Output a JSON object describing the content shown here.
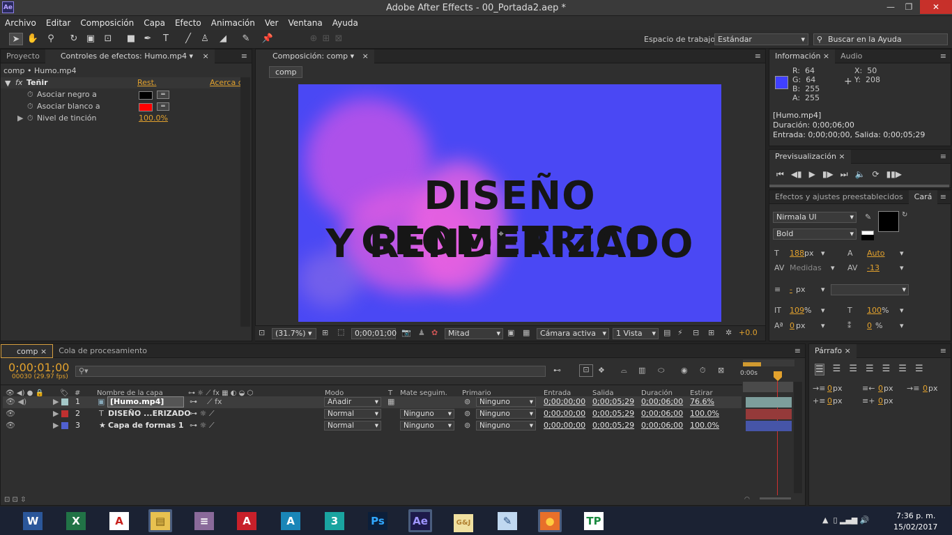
{
  "window": {
    "title": "Adobe After Effects - 00_Portada2.aep *",
    "app_badge": "Ae"
  },
  "menu": [
    "Archivo",
    "Editar",
    "Composición",
    "Capa",
    "Efecto",
    "Animación",
    "Ver",
    "Ventana",
    "Ayuda"
  ],
  "workspace": {
    "label": "Espacio de trabajo:",
    "value": "Estándar",
    "search_placeholder": "Buscar en la Ayuda"
  },
  "left_panel": {
    "tabs": [
      "Proyecto",
      "Controles de efectos: Humo.mp4"
    ],
    "breadcrumb": "comp • Humo.mp4",
    "effect_name": "Teñir",
    "reset": "Rest.",
    "about": "Acerca d",
    "params": [
      {
        "label": "Asociar negro a",
        "color": "#000000"
      },
      {
        "label": "Asociar blanco a",
        "color": "#ff0000"
      },
      {
        "label": "Nivel de tinción",
        "value": "100.0%"
      }
    ]
  },
  "viewer": {
    "tab": "Composición: comp",
    "comp_label": "comp",
    "line1": "DISEÑO GEOMETRICO",
    "line2": "Y RENDERIZADO",
    "bg_color": "#4a48f4",
    "zoom": "(31.7%)",
    "timecode": "0;00;01;00",
    "resolution": "Mitad",
    "camera": "Cámara activa",
    "views": "1 Vista",
    "exposure": "+0.0"
  },
  "info_panel": {
    "tabs": [
      "Información",
      "Audio"
    ],
    "r_label": "R:",
    "r": "64",
    "g_label": "G:",
    "g": "64",
    "b_label": "B:",
    "b": "255",
    "a_label": "A:",
    "a": "255",
    "x_label": "X:",
    "x": "50",
    "y_label": "Y:",
    "y": "208",
    "layer": "[Humo.mp4]",
    "duration": "Duración: 0;00;06;00",
    "inout": "Entrada: 0;00;00;00, Salida: 0;00;05;29",
    "swatch_color": "#4040ff"
  },
  "preview_panel": {
    "tab": "Previsualización"
  },
  "char_panel": {
    "tabs": [
      "Efectos y ajustes preestablecidos",
      "Cará"
    ],
    "font": "Nirmala UI",
    "style": "Bold",
    "size": "188",
    "size_unit": "px",
    "leading": "Auto",
    "kerning": "Medidas",
    "tracking": "-13",
    "stroke": "-",
    "stroke_unit": "px",
    "vscale": "109",
    "vscale_unit": "%",
    "hscale": "100",
    "hscale_unit": "%",
    "baseline": "0",
    "baseline_unit": "px",
    "tsume": "0",
    "tsume_unit": "%"
  },
  "timeline": {
    "tabs": [
      "comp",
      "Cola de procesamiento"
    ],
    "timecode": "0;00;01;00",
    "frame_info": "00030 (29.97 fps)",
    "columns": {
      "hash": "#",
      "name": "Nombre de la capa",
      "mode": "Modo",
      "t": "T",
      "matte": "Mate seguim.",
      "parent": "Primario",
      "in": "Entrada",
      "out": "Salida",
      "dur": "Duración",
      "stretch": "Estirar"
    },
    "ruler_start": "0:00s",
    "layers": [
      {
        "num": "1",
        "name": "[Humo.mp4]",
        "color": "#a4c8c8",
        "mode": "Añadir",
        "matte": "",
        "parent": "Ninguno",
        "in": "0;00;00;00",
        "out": "0;00;05;29",
        "dur": "0;00;06;00",
        "stretch": "76.6%",
        "bar": "#7d9e9c"
      },
      {
        "num": "2",
        "name": "DISEÑO ...ERIZADO",
        "color": "#c03030",
        "mode": "Normal",
        "matte": "Ninguno",
        "parent": "Ninguno",
        "in": "0;00;00;00",
        "out": "0;00;05;29",
        "dur": "0;00;06;00",
        "stretch": "100.0%",
        "bar": "#953a3a"
      },
      {
        "num": "3",
        "name": "Capa de formas 1",
        "color": "#5060d0",
        "mode": "Normal",
        "matte": "Ninguno",
        "parent": "Ninguno",
        "in": "0;00;00;00",
        "out": "0;00;05;29",
        "dur": "0;00;06;00",
        "stretch": "100.0%",
        "bar": "#4655a8"
      }
    ]
  },
  "paragraph_panel": {
    "tab": "Párrafo",
    "v1": "0",
    "v2": "0",
    "v3": "0",
    "v4": "0",
    "v5": "0",
    "unit": "px"
  },
  "taskbar": {
    "time": "7:36 p. m.",
    "date": "15/02/2017",
    "apps": [
      {
        "name": "word-icon",
        "glyph": "W",
        "bg": "#2b579a",
        "fg": "#ffffff"
      },
      {
        "name": "excel-icon",
        "glyph": "X",
        "bg": "#217346",
        "fg": "#ffffff"
      },
      {
        "name": "acrobat-icon",
        "glyph": "A",
        "bg": "#ffffff",
        "fg": "#c8201c"
      },
      {
        "name": "file-explorer-icon",
        "glyph": "▤",
        "bg": "#e8c150",
        "fg": "#7a5a10"
      },
      {
        "name": "archive-icon",
        "glyph": "≡",
        "bg": "#8a6a9a",
        "fg": "#ffffff"
      },
      {
        "name": "autocad-icon",
        "glyph": "A",
        "bg": "#c8202a",
        "fg": "#ffffff"
      },
      {
        "name": "autocad-civil-icon",
        "glyph": "A",
        "bg": "#1a86b8",
        "fg": "#ffffff"
      },
      {
        "name": "3dsmax-icon",
        "glyph": "3",
        "bg": "#1aa4a0",
        "fg": "#ffffff"
      },
      {
        "name": "photoshop-icon",
        "glyph": "Ps",
        "bg": "#0c1f3a",
        "fg": "#31a8ff"
      },
      {
        "name": "after-effects-icon",
        "glyph": "Ae",
        "bg": "#1d1a4a",
        "fg": "#9f95ff"
      },
      {
        "name": "gd-icon",
        "glyph": "G&J",
        "bg": "#f0e0a0",
        "fg": "#b08030"
      },
      {
        "name": "tools-icon",
        "glyph": "✎",
        "bg": "#c0d8f0",
        "fg": "#2a5080"
      },
      {
        "name": "firefox-icon",
        "glyph": "●",
        "bg": "#e8702a",
        "fg": "#ffcc40"
      },
      {
        "name": "toplink-icon",
        "glyph": "TP",
        "bg": "#ffffff",
        "fg": "#1a8a40"
      }
    ]
  }
}
